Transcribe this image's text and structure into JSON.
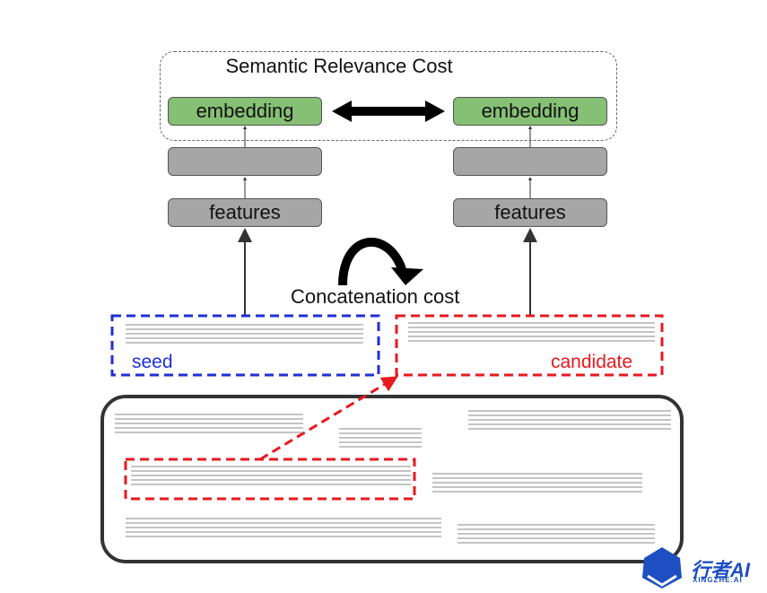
{
  "diagram": {
    "semantic_title": "Semantic Relevance Cost",
    "left": {
      "embedding": "embedding",
      "hidden": "",
      "features": "features"
    },
    "right": {
      "embedding": "embedding",
      "hidden": "",
      "features": "features"
    },
    "concat_label": "Concatenation cost",
    "seed_label": "seed",
    "candidate_label": "candidate",
    "colors": {
      "seed": "#1f2fd6",
      "candidate": "#e8191f",
      "embedding": "#85c074",
      "hidden": "#a6a6a6"
    }
  },
  "logo": {
    "text": "行者AI",
    "subtext": "XINGZHE.AI"
  }
}
